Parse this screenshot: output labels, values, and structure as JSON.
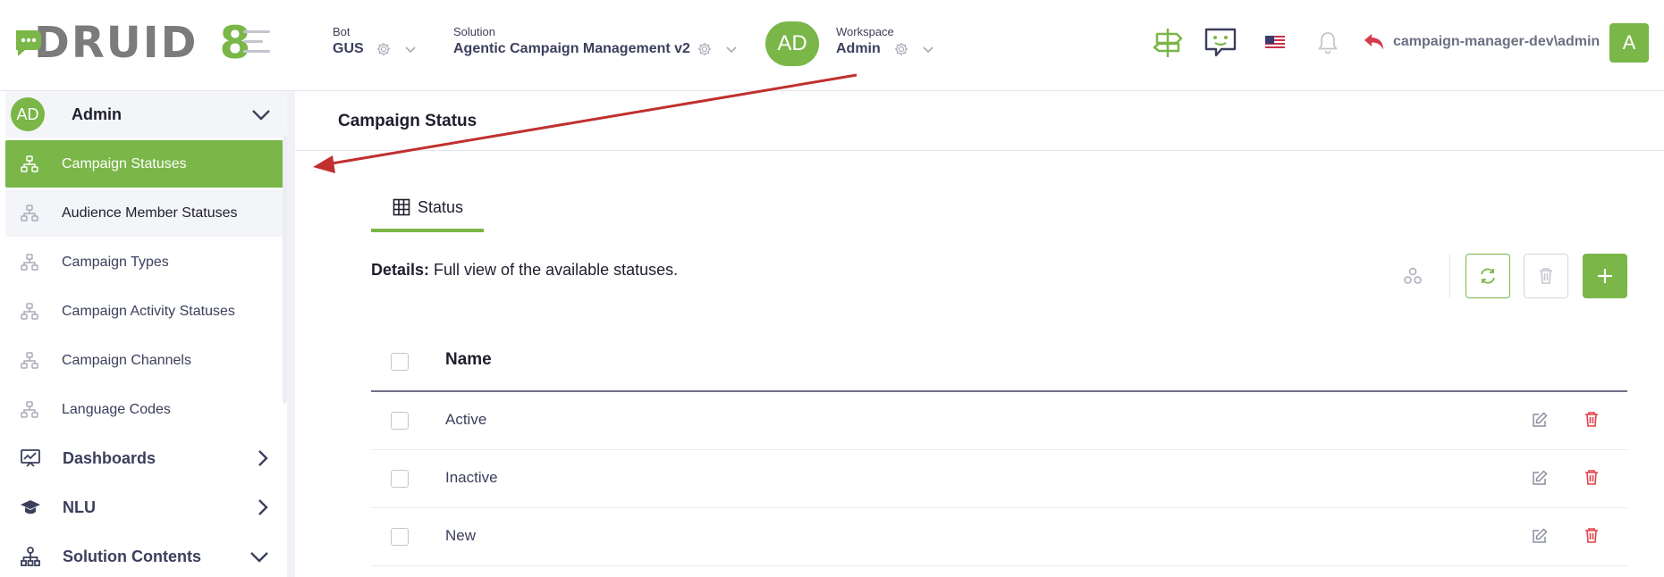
{
  "header": {
    "logo_text": "DRUID",
    "logo_version": "8",
    "bot": {
      "label": "Bot",
      "value": "GUS"
    },
    "solution": {
      "label": "Solution",
      "value": "Agentic Campaign Management v2"
    },
    "workspace": {
      "avatar": "AD",
      "label": "Workspace",
      "value": "Admin"
    },
    "user": {
      "name": "campaign-manager-dev\\admin",
      "avatar": "A"
    },
    "icons": [
      "signpost-icon",
      "chat-bot-icon",
      "us-flag-icon",
      "bell-icon",
      "back-arrow-icon"
    ]
  },
  "sidebar": {
    "user": {
      "avatar": "AD",
      "name": "Admin"
    },
    "items": [
      {
        "label": "Campaign Statuses",
        "state": "active"
      },
      {
        "label": "Audience Member Statuses",
        "state": "hover"
      },
      {
        "label": "Campaign Types",
        "state": "normal"
      },
      {
        "label": "Campaign Activity Statuses",
        "state": "normal"
      },
      {
        "label": "Campaign Channels",
        "state": "normal"
      },
      {
        "label": "Language Codes",
        "state": "normal"
      }
    ],
    "sections": [
      {
        "label": "Dashboards",
        "expanded": false
      },
      {
        "label": "NLU",
        "expanded": false
      },
      {
        "label": "Solution Contents",
        "expanded": true
      }
    ]
  },
  "main": {
    "title": "Campaign Status",
    "tab": "Status",
    "details_label": "Details:",
    "details_text": "Full view of the available statuses.",
    "table": {
      "column": "Name",
      "rows": [
        "Active",
        "Inactive",
        "New"
      ]
    }
  },
  "colors": {
    "accent": "#7ab648",
    "danger": "#e0404a",
    "annotation_arrow": "#c0302f"
  }
}
